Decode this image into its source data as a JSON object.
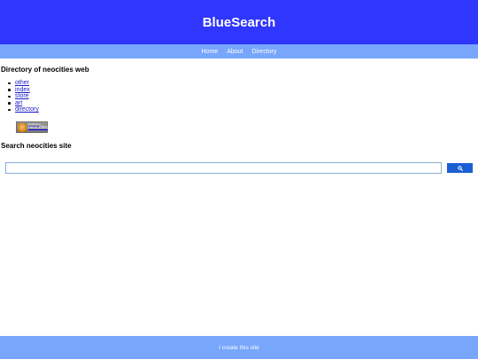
{
  "header": {
    "title": "BlueSearch"
  },
  "nav": {
    "items": [
      "Home",
      "About",
      "Directory"
    ]
  },
  "directory": {
    "title": "Directory of neocities web",
    "links": [
      "other",
      "index",
      "store",
      "art",
      "directory"
    ]
  },
  "badge": {
    "line1": "Hosted on",
    "line2": "neocities",
    "icon": "neocities-cat-icon"
  },
  "search": {
    "title": "Search neocities site",
    "input_value": "",
    "button_icon": "search-icon"
  },
  "footer": {
    "text": "I create this site"
  },
  "colors": {
    "header_bg": "#2f36fd",
    "nav_bg": "#78a6fb",
    "footer_bg": "#78a6fb",
    "button_bg": "#1a5fd4",
    "link": "#1a1acc"
  }
}
